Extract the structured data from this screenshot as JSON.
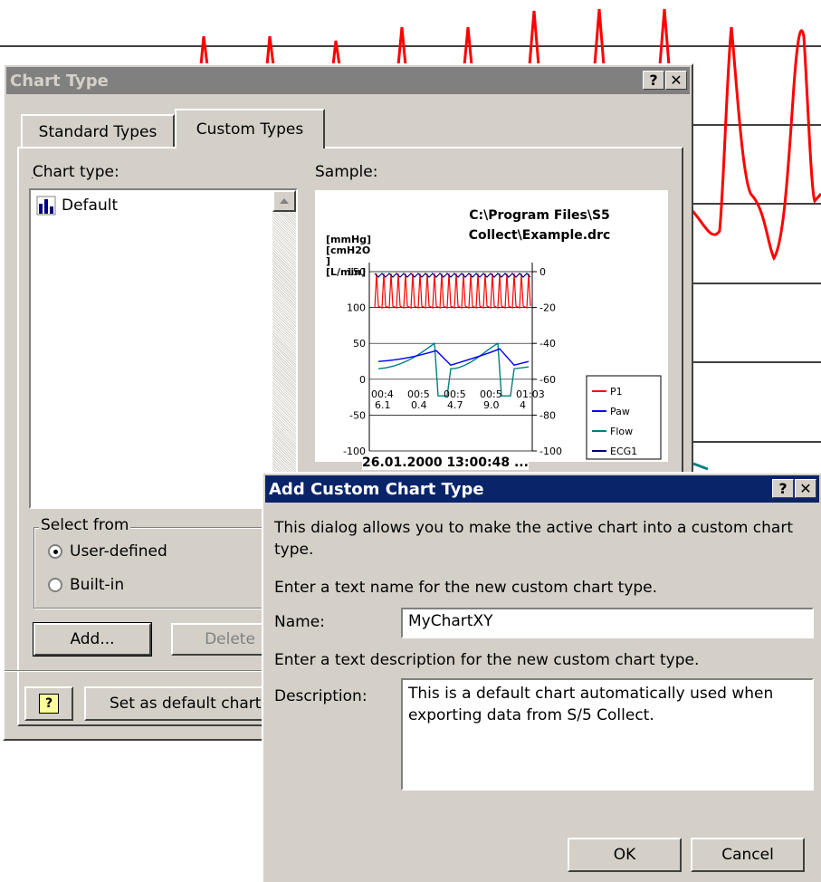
{
  "colors": {
    "chart_red": "#ff0000",
    "active_title": "#0a246a",
    "inactive_title": "#808080",
    "face": "#d4d0c8"
  },
  "chart_type_dialog": {
    "title": "Chart Type",
    "help_btn": "?",
    "close_btn": "✕",
    "tabs": [
      "Standard Types",
      "Custom Types"
    ],
    "chart_type_label": "Chart type:",
    "chart_type_items": [
      "Default"
    ],
    "sample_label": "Sample:",
    "select_from_label": "Select from",
    "radio_user": "User-defined",
    "radio_builtin": "Built-in",
    "add_btn": "Add...",
    "delete_btn": "Delete",
    "set_default_btn": "Set as default chart",
    "help_icon": "?"
  },
  "chart_data": {
    "type": "line",
    "title": "C:\\Program Files\\S5 Collect\\Example.drc",
    "title_lines": [
      "C:\\Program Files\\S5",
      "Collect\\Example.drc"
    ],
    "ylabel_lines": [
      "[mmHg]",
      "[cmH2O",
      "]",
      "[L/min]"
    ],
    "left_ticks": [
      "150",
      "100",
      "50",
      "0",
      "-50",
      "-100"
    ],
    "right_ticks": [
      "0",
      "-20",
      "-40",
      "-60",
      "-80",
      "-100"
    ],
    "x_ticks_top": [
      "00:4",
      "00:5",
      "00:5",
      "00:5",
      "01:03"
    ],
    "x_ticks_bottom": [
      "6.1",
      "0.4",
      "4.7",
      "9.0",
      "4"
    ],
    "xlabel": "26.01.2000 13:00:48 ...",
    "legend": [
      "P1",
      "Paw",
      "Flow",
      "ECG1"
    ],
    "series_colors": [
      "#ff0000",
      "#0000ff",
      "#008080",
      "#000080"
    ]
  },
  "add_dialog": {
    "title": "Add Custom Chart Type",
    "help_btn": "?",
    "close_btn": "✕",
    "intro": "This dialog allows you to make the active chart into a custom chart type.",
    "name_prompt": "Enter a text name for the new custom chart type.",
    "name_label": "Name:",
    "name_value": "MyChartXY",
    "desc_prompt": "Enter a text description for the new custom chart type.",
    "desc_label": "Description:",
    "desc_value": "This is a default chart automatically used when exporting data from S/5 Collect.",
    "ok_btn": "OK",
    "cancel_btn": "Cancel"
  }
}
